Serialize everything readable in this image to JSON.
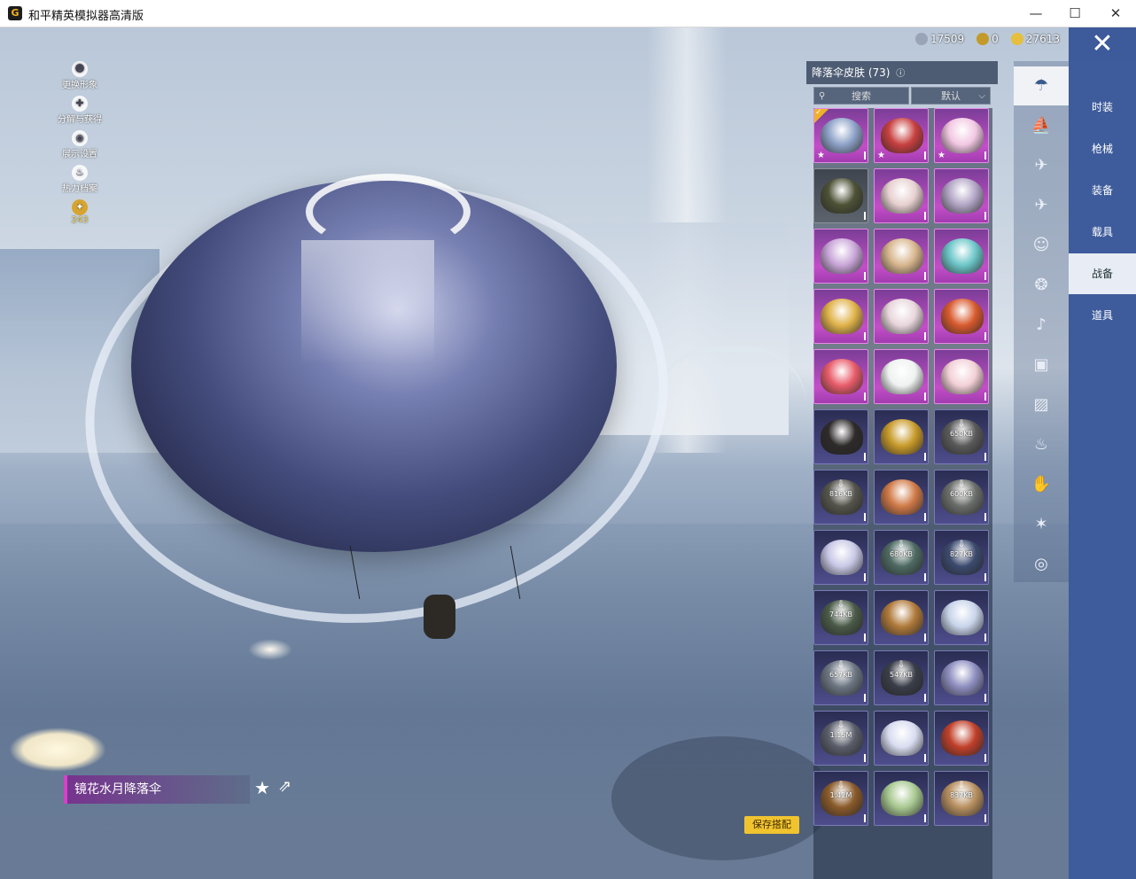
{
  "window": {
    "title": "和平精英模拟器高清版",
    "app_icon": "G",
    "minimize": "—",
    "maximize": "☐",
    "close": "✕"
  },
  "currency": {
    "items": [
      {
        "icon": "gem-icon",
        "value": "17509"
      },
      {
        "icon": "token-icon",
        "value": "0"
      },
      {
        "icon": "coin-icon",
        "value": "27613"
      }
    ]
  },
  "left_menu": {
    "items": [
      {
        "label": "更换形象"
      },
      {
        "label": "分解与获得"
      },
      {
        "label": "展示设置"
      },
      {
        "label": "热力档案"
      }
    ],
    "level": "243"
  },
  "panel": {
    "title": "降落伞皮肤 (73)",
    "info_icon": "ⓘ",
    "search_placeholder": "搜索",
    "sort_value": "默认"
  },
  "grid": [
    {
      "rarity": "legend",
      "color": "#8ea2c8",
      "star": true,
      "check": true
    },
    {
      "rarity": "legend",
      "color": "#c84040",
      "star": true
    },
    {
      "rarity": "legend",
      "color": "#f2c8e2",
      "star": true
    },
    {
      "rarity": "plain",
      "color": "#4d5236"
    },
    {
      "rarity": "legend",
      "color": "#e7d0d0"
    },
    {
      "rarity": "legend",
      "color": "#b3a6c6"
    },
    {
      "rarity": "legend",
      "color": "#c9a6d8"
    },
    {
      "rarity": "legend",
      "color": "#d8b68e"
    },
    {
      "rarity": "legend",
      "color": "#6cc6c8"
    },
    {
      "rarity": "legend",
      "color": "#e0b24a"
    },
    {
      "rarity": "legend",
      "color": "#e8d6dc"
    },
    {
      "rarity": "legend",
      "color": "#d85a2e"
    },
    {
      "rarity": "legend",
      "color": "#e85c6a"
    },
    {
      "rarity": "legend",
      "color": "#eef2f0"
    },
    {
      "rarity": "legend",
      "color": "#f2d0d6"
    },
    {
      "rarity": "epic",
      "color": "#2e2a2a"
    },
    {
      "rarity": "epic",
      "color": "#c89a2a"
    },
    {
      "rarity": "epic",
      "color": "#5a5a5a",
      "size": "650KB"
    },
    {
      "rarity": "epic",
      "color": "#55544c",
      "size": "816KB"
    },
    {
      "rarity": "epic",
      "color": "#d07a48"
    },
    {
      "rarity": "epic",
      "color": "#6a6e6a",
      "size": "600KB"
    },
    {
      "rarity": "epic",
      "color": "#c8c8e6"
    },
    {
      "rarity": "epic",
      "color": "#4e6a62",
      "size": "680KB"
    },
    {
      "rarity": "epic",
      "color": "#3c4a6e",
      "size": "827KB"
    },
    {
      "rarity": "epic",
      "color": "#4a5a48",
      "size": "744KB"
    },
    {
      "rarity": "epic",
      "color": "#b07a3a"
    },
    {
      "rarity": "epic",
      "color": "#c8d4ea"
    },
    {
      "rarity": "epic",
      "color": "#6c7682",
      "size": "657KB"
    },
    {
      "rarity": "epic",
      "color": "#3a3e48",
      "size": "547KB"
    },
    {
      "rarity": "epic",
      "color": "#8e8ec0"
    },
    {
      "rarity": "epic",
      "color": "#5a5e6a",
      "size": "1.15M"
    },
    {
      "rarity": "epic",
      "color": "#d8dcf0"
    },
    {
      "rarity": "epic",
      "color": "#c0402a"
    },
    {
      "rarity": "epic",
      "color": "#8a5a2a",
      "size": "1.42M"
    },
    {
      "rarity": "epic",
      "color": "#a8c890"
    },
    {
      "rarity": "epic",
      "color": "#b89060",
      "size": "837KB"
    }
  ],
  "categories": [
    {
      "icon": "parachute-icon",
      "glyph": "☂",
      "active": true
    },
    {
      "icon": "boat-icon",
      "glyph": "⛵"
    },
    {
      "icon": "plane-trail-icon",
      "glyph": "✈"
    },
    {
      "icon": "airplane-icon",
      "glyph": "✈"
    },
    {
      "icon": "emote-icon",
      "glyph": "☺"
    },
    {
      "icon": "pet-icon",
      "glyph": "❂"
    },
    {
      "icon": "voice-icon",
      "glyph": "♪"
    },
    {
      "icon": "box-icon",
      "glyph": "▣"
    },
    {
      "icon": "picture-icon",
      "glyph": "▨"
    },
    {
      "icon": "extinguisher-icon",
      "glyph": "♨"
    },
    {
      "icon": "grenade-icon",
      "glyph": "✋"
    },
    {
      "icon": "firework-icon",
      "glyph": "✶"
    },
    {
      "icon": "plate-icon",
      "glyph": "◎"
    }
  ],
  "tabs": [
    {
      "label": "时装"
    },
    {
      "label": "枪械"
    },
    {
      "label": "装备"
    },
    {
      "label": "载具"
    },
    {
      "label": "战备",
      "active": true
    },
    {
      "label": "道具"
    }
  ],
  "item_name": "镜花水月降落伞",
  "save_button": "保存搭配"
}
